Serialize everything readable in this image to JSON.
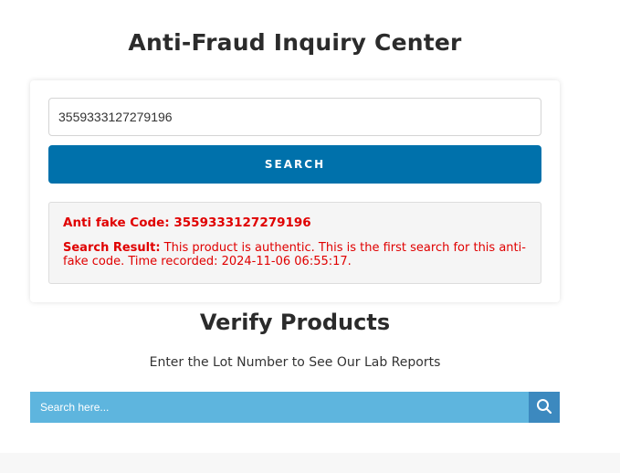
{
  "header": {
    "title": "Anti-Fraud Inquiry Center"
  },
  "inquiry": {
    "code_value": "3559333127279196",
    "search_label": "SEARCH",
    "result": {
      "code_line": "Anti fake Code: 3559333127279196",
      "label": "Search Result:",
      "message": " This product is authentic. This is the first search for this anti-fake code. Time recorded: 2024-11-06 06:55:17."
    }
  },
  "verify": {
    "title": "Verify Products",
    "subtitle": "Enter the Lot Number to See Our Lab Reports",
    "search_placeholder": "Search here...",
    "search_icon": "search-icon"
  },
  "colors": {
    "accent": "#0071ab",
    "result_text": "#e00000",
    "lot_search_bg": "#5eb5de",
    "lot_button_bg": "#3c89bf"
  }
}
